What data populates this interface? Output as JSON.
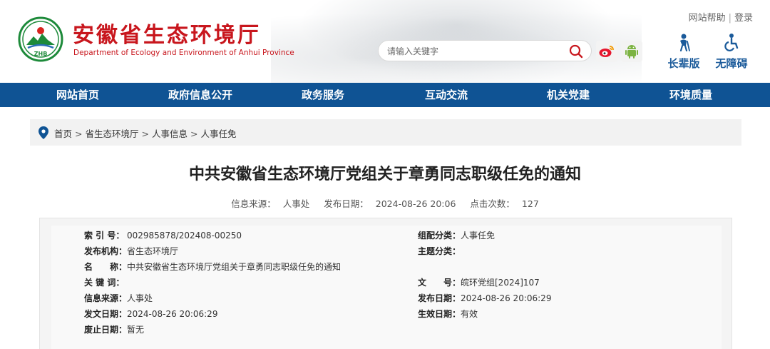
{
  "header": {
    "title": "安徽省生态环境厅",
    "subtitle": "Department of Ecology and Environment of Anhui Province",
    "logo_text": "ZHB",
    "top_links": [
      "网站帮助",
      "登录"
    ],
    "search_placeholder": "请输入关键字",
    "tools": [
      {
        "label": "长辈版",
        "icon": "elder-mode-icon"
      },
      {
        "label": "无障碍",
        "icon": "accessibility-icon"
      }
    ],
    "social_icons": [
      "weibo-icon",
      "android-icon"
    ]
  },
  "nav": {
    "items": [
      "网站首页",
      "政府信息公开",
      "政务服务",
      "互动交流",
      "机关党建",
      "环境质量"
    ]
  },
  "breadcrumb": {
    "items": [
      "首页",
      "省生态环境厅",
      "人事信息",
      "人事任免"
    ],
    "separator": ">"
  },
  "article": {
    "title": "中共安徽省生态环境厅党组关于章勇同志职级任免的通知",
    "meta": {
      "source_label": "信息来源：",
      "source": "人事处",
      "date_label": "发布日期：",
      "date": "2024-08-26 20:06",
      "clicks_label": "点击次数：",
      "clicks": "127"
    }
  },
  "info": {
    "index_label": "索 引 号：",
    "index": "002985878/202408-00250",
    "category_label": "组配分类：",
    "category": "人事任免",
    "publisher_label": "发布机构：",
    "publisher": "省生态环境厅",
    "topic_label": "主题分类：",
    "topic": "",
    "name_label": "名　　称：",
    "name": "中共安徽省生态环境厅党组关于章勇同志职级任免的通知",
    "keywords_label": "关 键 词：",
    "keywords": "",
    "docno_label": "文　　号：",
    "docno": "皖环党组[2024]107",
    "source_label": "信息来源：",
    "source": "人事处",
    "pubdate_label": "发布日期：",
    "pubdate": "2024-08-26 20:06:29",
    "issuedate_label": "发文日期：",
    "issuedate": "2024-08-26 20:06:29",
    "effective_label": "生效日期：",
    "effective": "有效",
    "expiry_label": "废止日期：",
    "expiry": "暂无"
  },
  "colors": {
    "brand_red": "#c8161d",
    "nav_blue": "#0f5394",
    "tool_blue": "#1a5a9a"
  }
}
